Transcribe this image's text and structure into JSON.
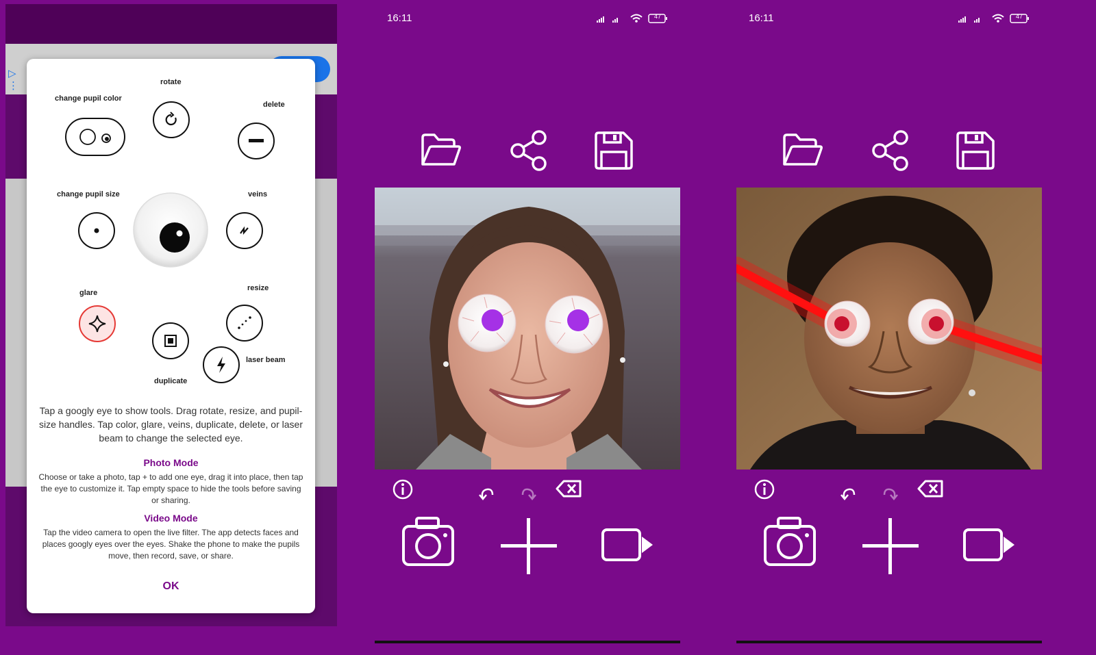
{
  "help_dialog": {
    "tools": {
      "rotate": "rotate",
      "change_pupil_color": "change pupil color",
      "delete": "delete",
      "change_pupil_size": "change pupil size",
      "veins": "veins",
      "glare": "glare",
      "resize": "resize",
      "duplicate": "duplicate",
      "laser_beam": "laser beam"
    },
    "main_text": "Tap a googly eye to show tools. Drag rotate, resize, and pupil-size handles. Tap color, glare, veins, duplicate, delete, or laser beam to change the selected eye.",
    "photo_mode_title": "Photo Mode",
    "photo_mode_text": "Choose or take a photo, tap + to add one eye, drag it into place, then tap the eye to customize it. Tap empty space to hide the tools before saving or sharing.",
    "video_mode_title": "Video Mode",
    "video_mode_text": "Tap the video camera to open the live filter. The app detects faces and places googly eyes over the eyes. Shake the phone to make the pupils move, then record, save, or share.",
    "ok_label": "OK"
  },
  "screens": [
    {
      "status_time": "16:11",
      "battery": "47"
    },
    {
      "status_time": "16:11",
      "battery": "47"
    }
  ],
  "colors": {
    "app_purple": "#7a0a8a",
    "pupil_purple": "#a531e6",
    "pupil_red": "#c8102e",
    "laser_red": "#ff1010",
    "glare_accent": "#e53935"
  }
}
